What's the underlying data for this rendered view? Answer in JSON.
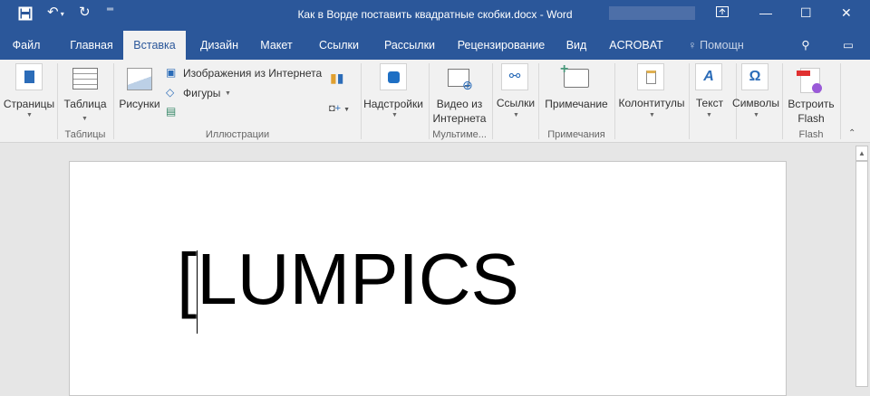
{
  "window": {
    "title": "Как в Ворде поставить квадратные скобки.docx - Word"
  },
  "quick_access": {
    "save": "save-icon",
    "undo": "undo-icon",
    "redo": "redo-icon",
    "customize": "customize-icon"
  },
  "tabs": [
    {
      "label": "Файл"
    },
    {
      "label": "Главная"
    },
    {
      "label": "Вставка"
    },
    {
      "label": "Дизайн"
    },
    {
      "label": "Макет"
    },
    {
      "label": "Ссылки"
    },
    {
      "label": "Рассылки"
    },
    {
      "label": "Рецензирование"
    },
    {
      "label": "Вид"
    },
    {
      "label": "ACROBAT"
    }
  ],
  "help": {
    "label": "Помощн"
  },
  "ribbon": {
    "pages": "Страницы",
    "table": "Таблица",
    "tables_group": "Таблицы",
    "pictures": "Рисунки",
    "online_pictures": "Изображения из Интернета",
    "shapes": "Фигуры",
    "illustrations_group": "Иллюстрации",
    "addins": "Надстройки",
    "video1": "Видео из",
    "video2": "Интернета",
    "media_group": "Мультиме...",
    "links": "Ссылки",
    "comment": "Примечание",
    "comments_group": "Примечания",
    "header_footer": "Колонтитулы",
    "text": "Текст",
    "symbols": "Символы",
    "flash1": "Встроить",
    "flash2": "Flash",
    "flash_group": "Flash"
  },
  "document": {
    "text": "[LUMPICS"
  },
  "colors": {
    "accent": "#2b579a",
    "ribbon": "#f1f1f1"
  }
}
